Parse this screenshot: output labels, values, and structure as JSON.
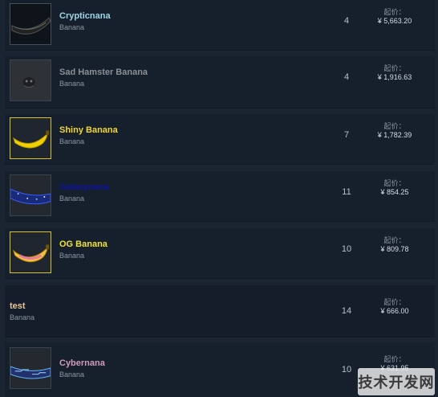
{
  "price_prefix": "起价：",
  "items": [
    {
      "name": "Crypticnana",
      "type": "Banana",
      "qty": "4",
      "price": "¥ 5,663.20",
      "name_color": "#9fd5e8",
      "icon": "black-banana-icon"
    },
    {
      "name": "Sad Hamster Banana",
      "type": "Banana",
      "qty": "4",
      "price": "¥ 1,916.63",
      "name_color": "#8b8f94",
      "icon": "hamster-banana-icon"
    },
    {
      "name": "Shiny Banana",
      "type": "Banana",
      "qty": "7",
      "price": "¥ 1,782.39",
      "name_color": "#f0d632",
      "icon": "yellow-banana-icon"
    },
    {
      "name": "Galaxynana",
      "type": "Banana",
      "qty": "11",
      "price": "¥ 854.25",
      "name_color": "#10129e",
      "icon": "galaxy-banana-icon"
    },
    {
      "name": "OG Banana",
      "type": "Banana",
      "qty": "10",
      "price": "¥ 809.78",
      "name_color": "#f0e232",
      "icon": "og-banana-icon"
    },
    {
      "name": "test",
      "type": "Banana",
      "qty": "14",
      "price": "¥ 666.00",
      "name_color": "#e7c79b",
      "icon": ""
    },
    {
      "name": "Cybernana",
      "type": "Banana",
      "qty": "10",
      "price": "¥ 631.95",
      "name_color": "#d39ab8",
      "icon": "cyber-banana-icon"
    }
  ],
  "watermark": "技术开发网"
}
